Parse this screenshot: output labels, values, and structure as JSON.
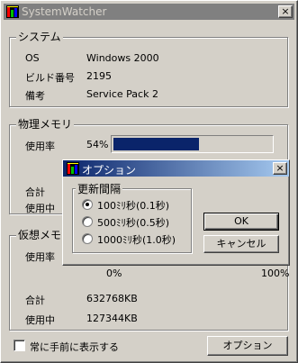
{
  "window": {
    "title": "SystemWatcher",
    "close_glyph": "×",
    "icon": "app-icon"
  },
  "system": {
    "group_label": "システム",
    "rows": [
      {
        "label": "OS",
        "value": "Windows 2000"
      },
      {
        "label": "ビルド番号",
        "value": "2195"
      },
      {
        "label": "備考",
        "value": "Service Pack 2"
      }
    ]
  },
  "physical": {
    "group_label": "物理メモリ",
    "usage_label": "使用率",
    "usage_percent_text": "54%",
    "usage_fraction": 0.54,
    "total_label": "合計",
    "used_label": "使用中"
  },
  "virtual": {
    "group_label": "仮想メモリ",
    "usage_label": "使用率",
    "scale_min": "0%",
    "scale_max": "100%",
    "total_label": "合計",
    "total_value": "632768KB",
    "used_label": "使用中",
    "used_value": "127344KB"
  },
  "footer": {
    "always_on_top_label": "常に手前に表示する",
    "always_on_top_checked": false,
    "options_button": "オプション"
  },
  "dialog": {
    "title": "オプション",
    "close_glyph": "×",
    "group_label": "更新間隔",
    "options": [
      {
        "label": "100ﾐﾘ秒(0.1秒)",
        "selected": true
      },
      {
        "label": "500ﾐﾘ秒(0.5秒)",
        "selected": false
      },
      {
        "label": "1000ﾐﾘ秒(1.0秒)",
        "selected": false
      }
    ],
    "ok_button": "OK",
    "cancel_button": "キャンセル"
  },
  "colors": {
    "face": "#d4d0c8",
    "progress_fill": "#0a246a",
    "active_title": "#0a246a",
    "inactive_title": "#808080"
  }
}
